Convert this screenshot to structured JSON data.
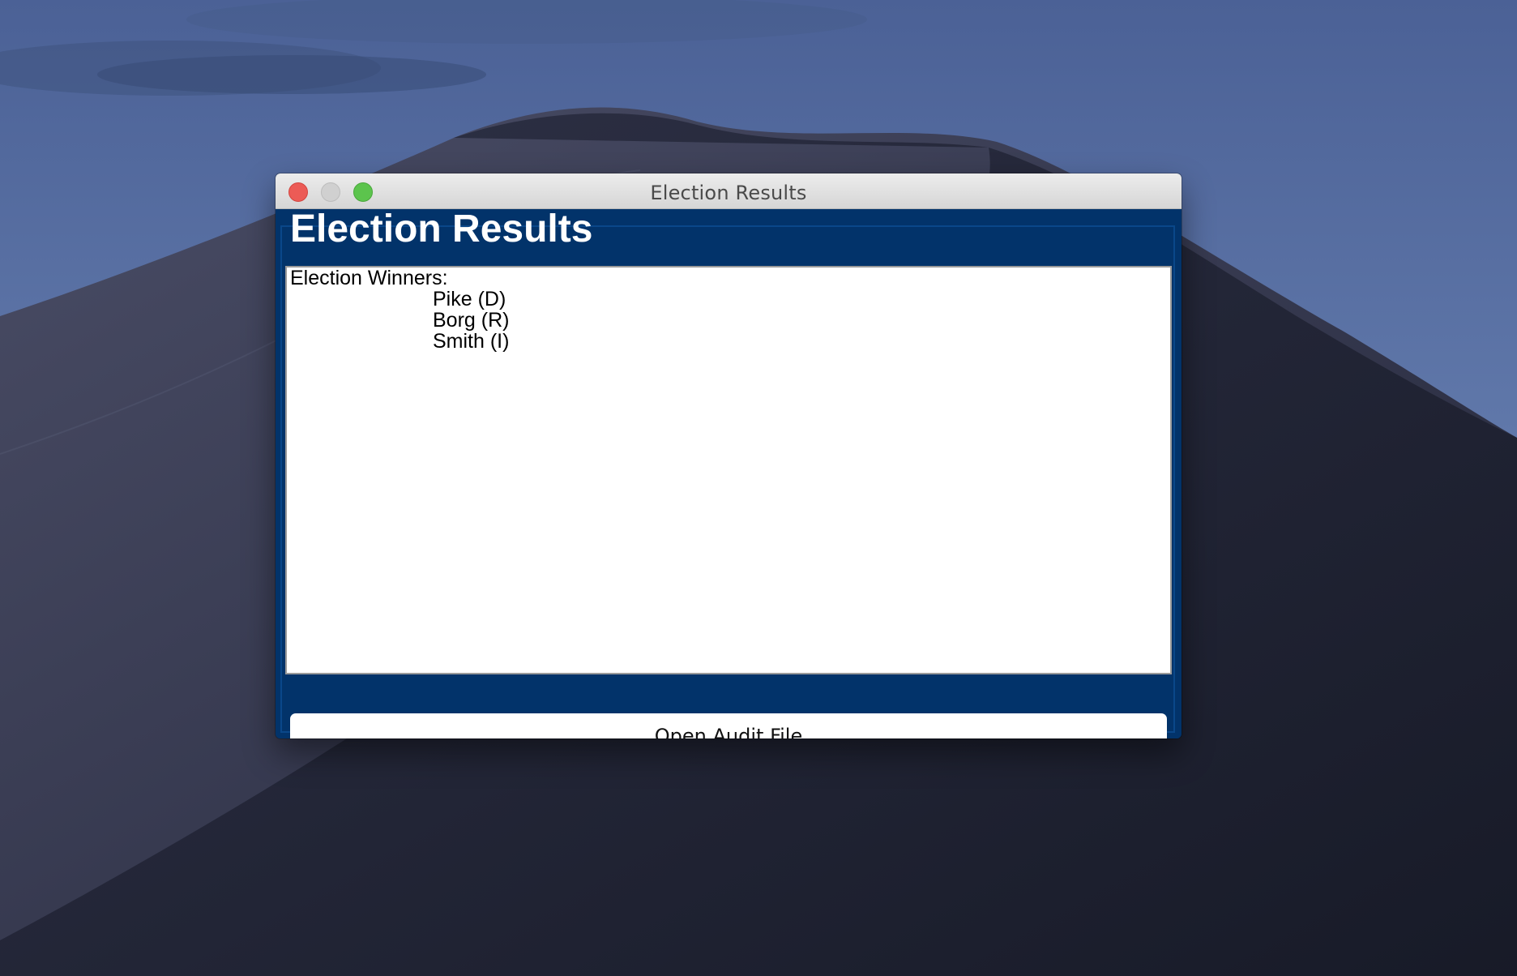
{
  "window": {
    "title": "Election Results"
  },
  "header": {
    "title": "Election Results"
  },
  "results": {
    "heading": "Election Winners:",
    "winners": [
      "Pike (D)",
      "Borg (R)",
      "Smith (I)"
    ]
  },
  "actions": {
    "open_audit_label": "Open Audit File"
  },
  "colors": {
    "panel_background": "#02336a",
    "text_area_background": "#ffffff",
    "close_button": "#ec5b56",
    "zoom_button": "#5cc44d"
  },
  "icons": {
    "close": "close-traffic-light-icon",
    "minimize": "minimize-traffic-light-icon",
    "zoom": "zoom-traffic-light-icon"
  }
}
